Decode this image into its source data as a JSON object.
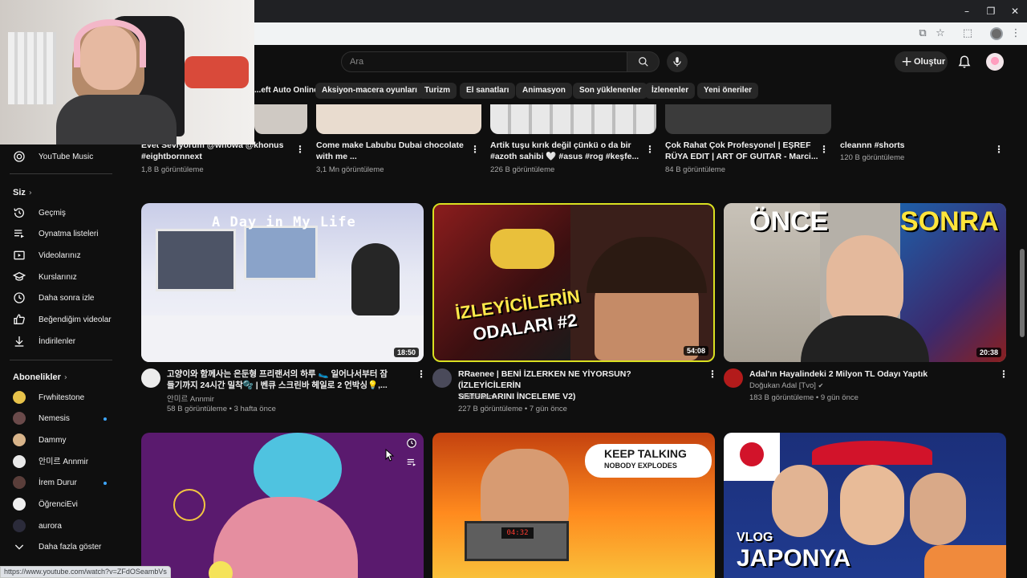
{
  "search": {
    "placeholder": "Ara"
  },
  "header": {
    "create_label": "Oluştur"
  },
  "chips": [
    "...eft Auto Online",
    "Aksiyon-macera oyunları",
    "Turizm",
    "El sanatları",
    "Animasyon",
    "Son yüklenenler",
    "İzlenenler",
    "Yeni öneriler"
  ],
  "sidebar": {
    "music_label": "YouTube Music",
    "you_title": "Siz",
    "you_items": [
      "Geçmiş",
      "Oynatma listeleri",
      "Videolarınız",
      "Kurslarınız",
      "Daha sonra izle",
      "Beğendiğim videolar",
      "İndirilenler"
    ],
    "subs_title": "Abonelikler",
    "subs_items": [
      "Frwhitestone",
      "Nemesis",
      "Dammy",
      "안미르 Annmir",
      "İrem Durur",
      "ÖğrenciEvi",
      "aurora"
    ],
    "show_more": "Daha fazla göster"
  },
  "top_row": [
    {
      "title_line1": "Evet Seviyorum @whowa @khonus",
      "title_line2": "#eightbornnext",
      "meta": "1,8 B görüntüleme"
    },
    {
      "title_line1": "Come make Labubu Dubai chocolate",
      "title_line2": "with me ...",
      "meta": "3,1 Mn görüntüleme"
    },
    {
      "title_line1": "Artik tuşu kırık değil çünkü o da bir",
      "title_line2": "#azoth sahibi 🤍 #asus #rog #keşfe...",
      "meta": "226 B görüntüleme"
    },
    {
      "title_line1": "Çok Rahat Çok Profesyonel | EŞREF",
      "title_line2": "RÜYA EDIT | ART OF GUITAR - Marci...",
      "meta": "84 B görüntüleme"
    },
    {
      "title_line1": "cleannn #shorts",
      "title_line2": "",
      "meta": "120 B görüntüleme"
    }
  ],
  "videos": [
    {
      "title_line1": "고양이와 함께사는 은둔형 프리랜서의 하루 🥿 일어나서부터 잠",
      "title_line2": "들기까지 24시간 밀착🫧 | 벤큐 스크린바 헤일로 2 언박싱💡,...",
      "channel": "안미르 Annmir",
      "meta": "58 B görüntüleme • 3 hafta önce",
      "duration": "18:50",
      "overlay": "A Day in My Life"
    },
    {
      "title_line1": "RRaenee | BENİ İZLERKEN NE YİYORSUN? (İZLEYİCİLERİN",
      "title_line2": "SETUPLARINI İNCELEME V2)",
      "channel": "TibetRaenn",
      "meta": "227 B görüntüleme • 7 gün önce",
      "duration": "54:08",
      "overlay_line1": "İZLEYİCİLERİN",
      "overlay_line2": "ODALARI #2"
    },
    {
      "title_line1": "Adal'ın Hayalindeki 2 Milyon TL Odayı Yaptık",
      "title_line2": "",
      "channel": "Doğukan Adal [Tvo]",
      "meta": "183 B görüntüleme • 9 gün önce",
      "duration": "20:38",
      "overlay_left": "ÖNCE",
      "overlay_right": "SONRA"
    }
  ],
  "bottom_row": [
    {
      "overlay": ""
    },
    {
      "overlay_line1": "KEEP TALKING",
      "overlay_line2": "NOBODY EXPLODES"
    },
    {
      "overlay_line1": "VLOG",
      "overlay_line2": "JAPONYA"
    }
  ],
  "statusbar_url": "https://www.youtube.com/watch?v=ZFdOSeambVs"
}
